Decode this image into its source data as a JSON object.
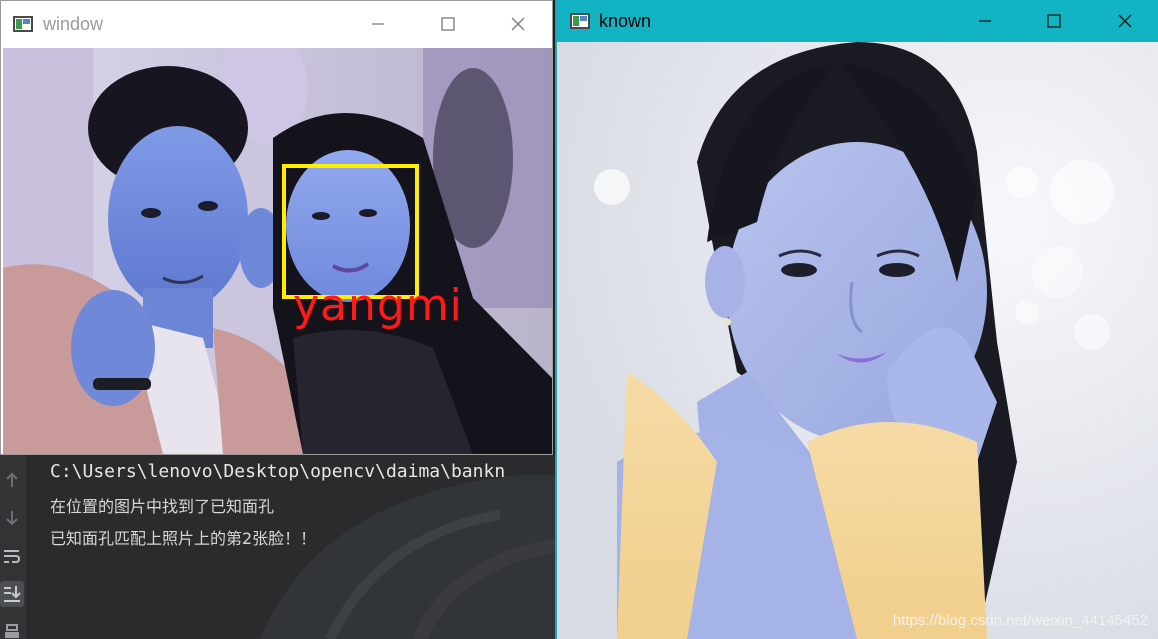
{
  "windows": {
    "left": {
      "title": "window",
      "detection": {
        "label": "yangmi",
        "box_color": "#ffee00",
        "label_color": "#ff1a1a"
      }
    },
    "right": {
      "title": "known",
      "titlebar_color": "#12b4c4",
      "watermark": "https://blog.csdn.net/weixin_44145452"
    }
  },
  "console": {
    "lines": [
      "C:\\Users\\lenovo\\Desktop\\opencv\\daima\\bankn",
      "在位置的图片中找到了已知面孔",
      "已知面孔匹配上照片上的第2张脸！！"
    ],
    "gutter_icons": [
      "arrow-up-icon",
      "arrow-down-icon",
      "soft-wrap-icon",
      "scroll-to-end-icon",
      "print-icon"
    ]
  }
}
